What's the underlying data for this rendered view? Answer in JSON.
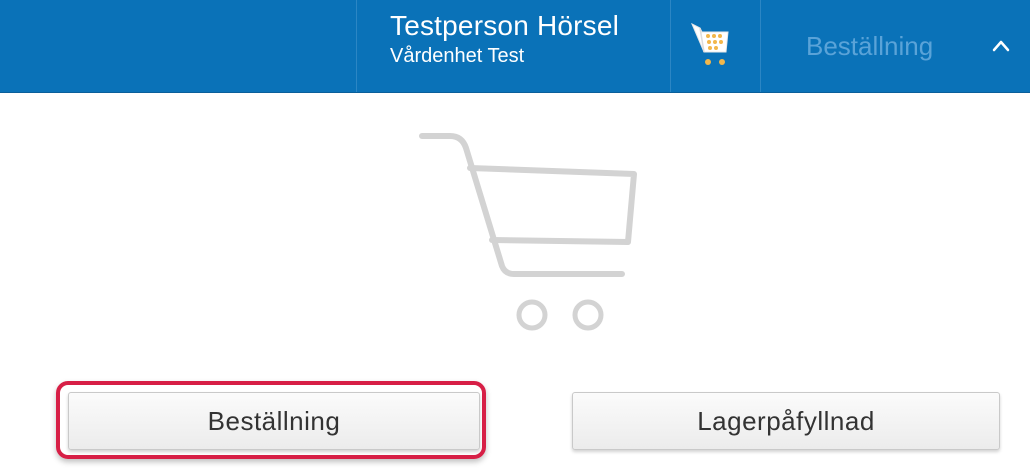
{
  "header": {
    "user_name": "Testperson Hörsel",
    "unit_name": "Vårdenhet Test",
    "cart_icon": "shopping-cart-icon",
    "order_menu_label": "Beställning",
    "chevron_icon": "chevron-up-icon",
    "background_color": "#0a72b8"
  },
  "main": {
    "empty_cart_icon": "shopping-cart-icon",
    "buttons": {
      "order_label": "Beställning",
      "restock_label": "Lagerpåfyllnad"
    },
    "highlight_color": "#d71f46"
  }
}
